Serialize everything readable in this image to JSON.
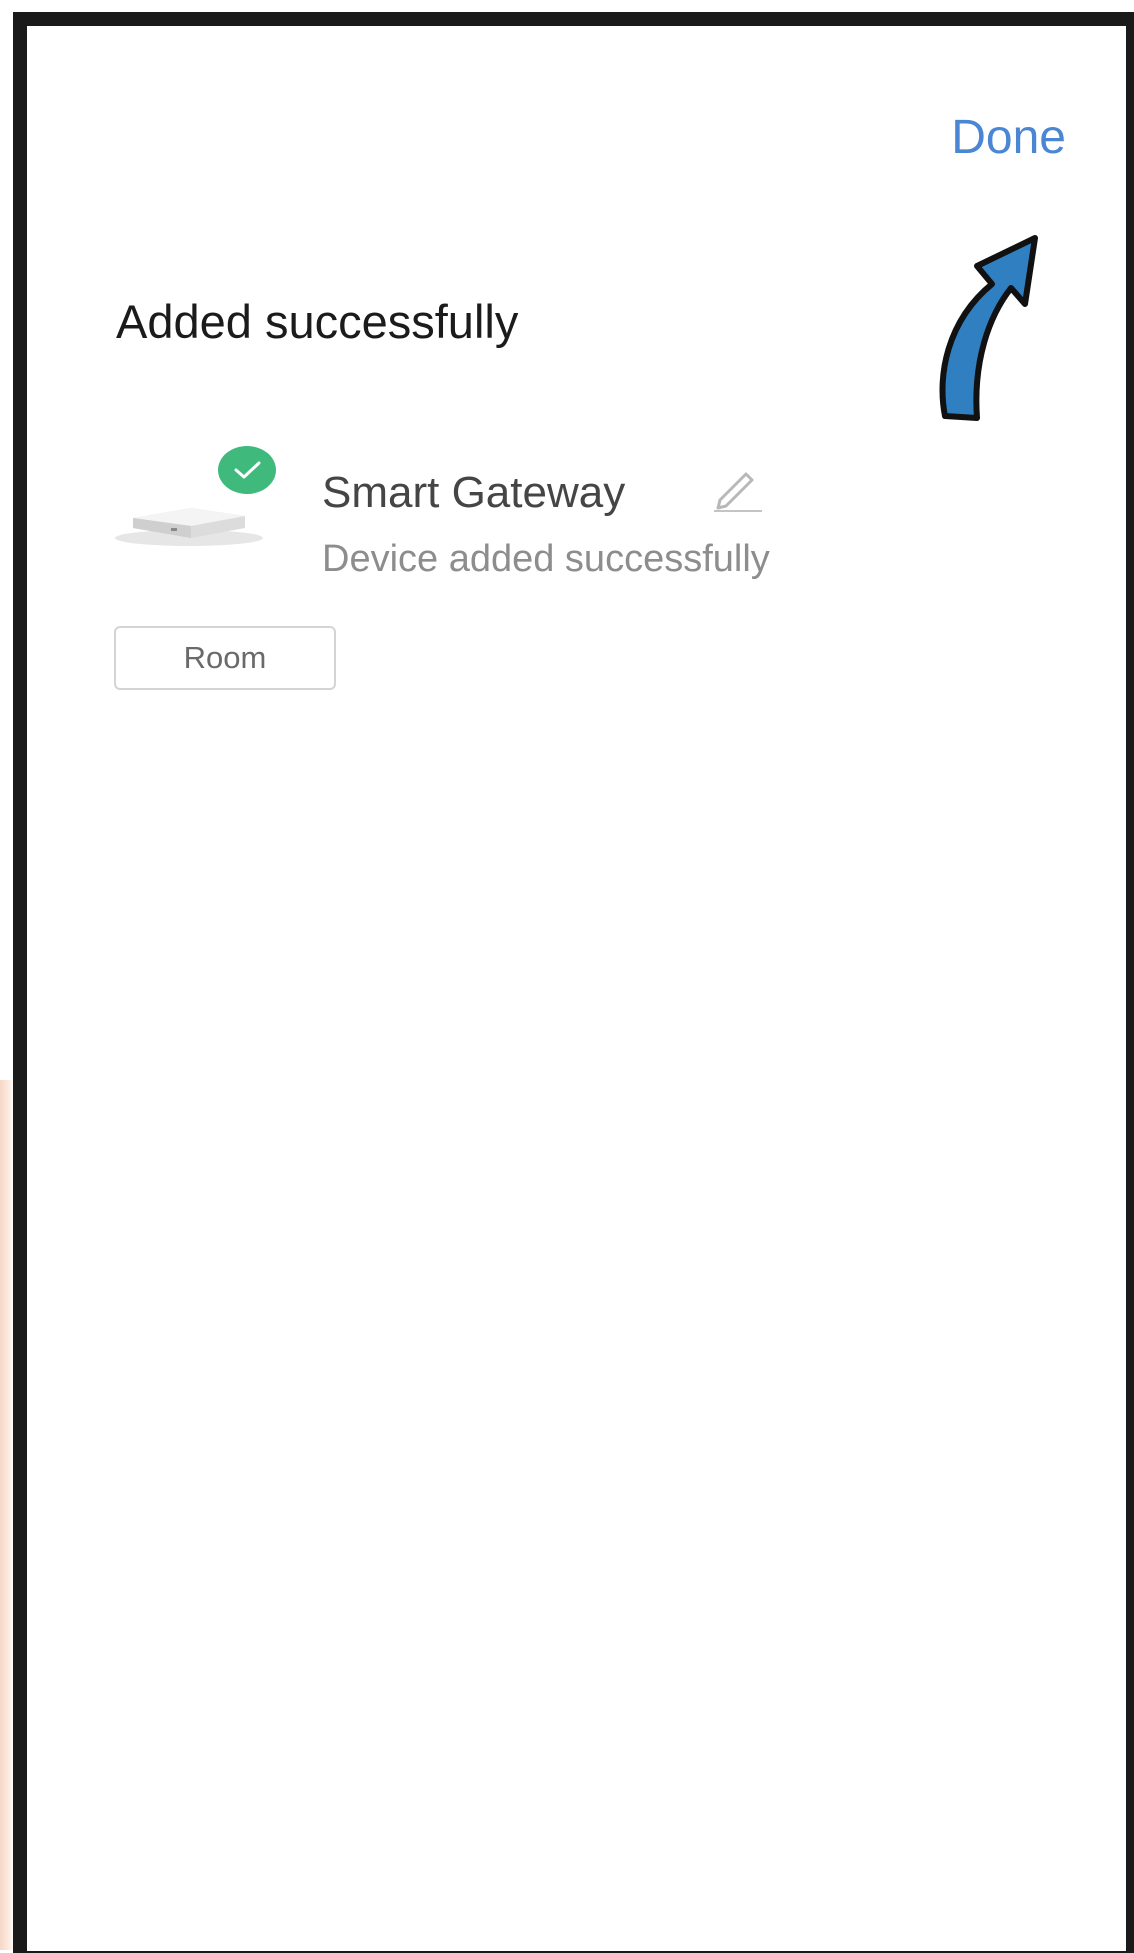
{
  "header": {
    "done_label": "Done"
  },
  "page": {
    "title": "Added successfully"
  },
  "device": {
    "name": "Smart Gateway",
    "status": "Device added successfully",
    "image_icon": "gateway-device-image",
    "badge_icon": "check-icon",
    "edit_icon": "pencil-icon"
  },
  "room_button": {
    "label": "Room"
  },
  "annotation": {
    "icon": "arrow-pointer-icon"
  },
  "colors": {
    "accent": "#4a86d4",
    "success": "#3fba7c",
    "arrow": "#2f7fc1",
    "frame": "#1a1a1a",
    "title_text": "#1b1b1b",
    "secondary_text": "#8d8d8d"
  }
}
